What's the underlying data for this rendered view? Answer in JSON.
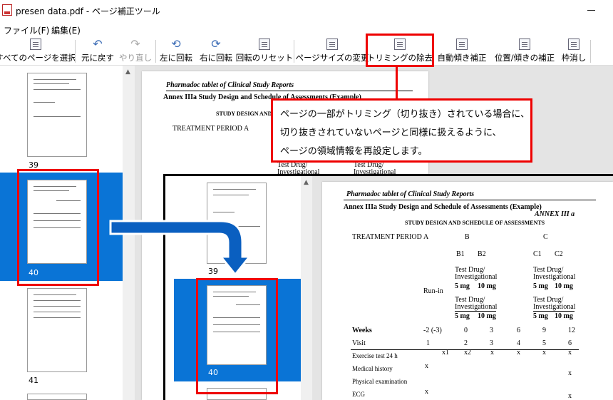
{
  "window": {
    "title": "presen data.pdf - ページ補正ツール"
  },
  "menu": {
    "file": "ファイル(F)",
    "edit": "編集(E)"
  },
  "toolbar": {
    "select_all": "すべてのページを選択",
    "undo": "元に戻す",
    "redo": "やり直し",
    "rotate_left": "左に回転",
    "rotate_right": "右に回転",
    "reset_rotation": "回転のリセット",
    "change_page_size": "ページサイズの変更",
    "remove_trimming": "トリミングの除去",
    "auto_deskew": "自動傾き補正",
    "position_deskew": "位置/傾きの補正",
    "remove_frame": "枠消し"
  },
  "thumbnails": {
    "page_39": "39",
    "page_40": "40",
    "page_41": "41"
  },
  "inset_thumbnails": {
    "page_39": "39",
    "page_40": "40"
  },
  "callout": {
    "line1": "ページの一部がトリミング（切り抜き）されている場合に、",
    "line2": "切り抜きされていないページと同様に扱えるように、",
    "line3": "ページの領域情報を再設定します。"
  },
  "document": {
    "header": "Pharmadoc tablet of Clinical Study Reports",
    "annex_title": "Annex IIIa   Study Design and Schedule of Assessments (Example)",
    "annex_tag": "ANNEX III a",
    "subtitle": "STUDY DESIGN AND SCHEDULE OF ASSESSMENTS",
    "treatment_period": "TREATMENT PERIOD",
    "col_a": "A",
    "col_b": "B",
    "col_c": "C",
    "b1": "B1",
    "b2": "B2",
    "c1": "C1",
    "c2": "C2",
    "test_drug": "Test Drug/",
    "investigational": "Investigational",
    "dose_5": "5 mg",
    "dose_10": "10 mg",
    "run_in": "Run-in",
    "weeks": "Weeks",
    "weeks_values": [
      "-2 (-3)",
      "0",
      "3",
      "6",
      "9",
      "12"
    ],
    "visit": "Visit",
    "visit_values": [
      "1",
      "2",
      "3",
      "4",
      "5",
      "6"
    ],
    "exercise_test": "Exercise test 24 h",
    "medical_history": "Medical history",
    "physical_exam": "Physical examination",
    "ecg": "ECG",
    "x_mark": "x",
    "x1": "x1",
    "x2": "x2"
  }
}
